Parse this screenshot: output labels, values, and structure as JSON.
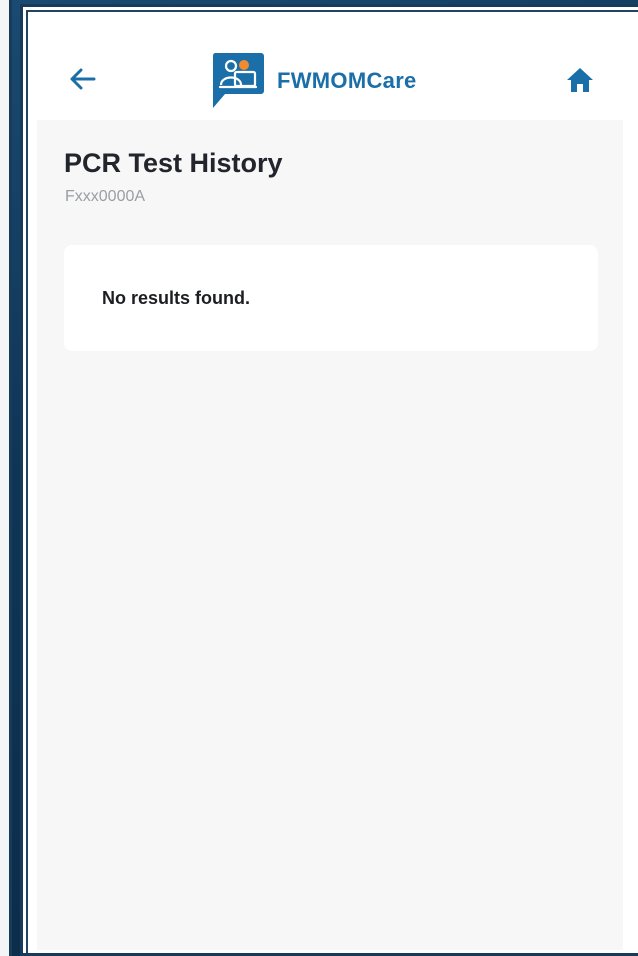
{
  "app": {
    "name": "FWMOMCare"
  },
  "header": {
    "back_icon": "arrow-left-icon",
    "home_icon": "home-icon",
    "logo_icon": "people-chat-logo-icon"
  },
  "page": {
    "title": "PCR Test History",
    "subtitle": "Fxxx0000A"
  },
  "results": {
    "empty_message": "No results found."
  },
  "colors": {
    "brand": "#1b6fa9",
    "frame": "#183b5c",
    "content_bg": "#f7f7f8",
    "title_text": "#22252b",
    "subtitle_text": "#9a9ea4"
  }
}
